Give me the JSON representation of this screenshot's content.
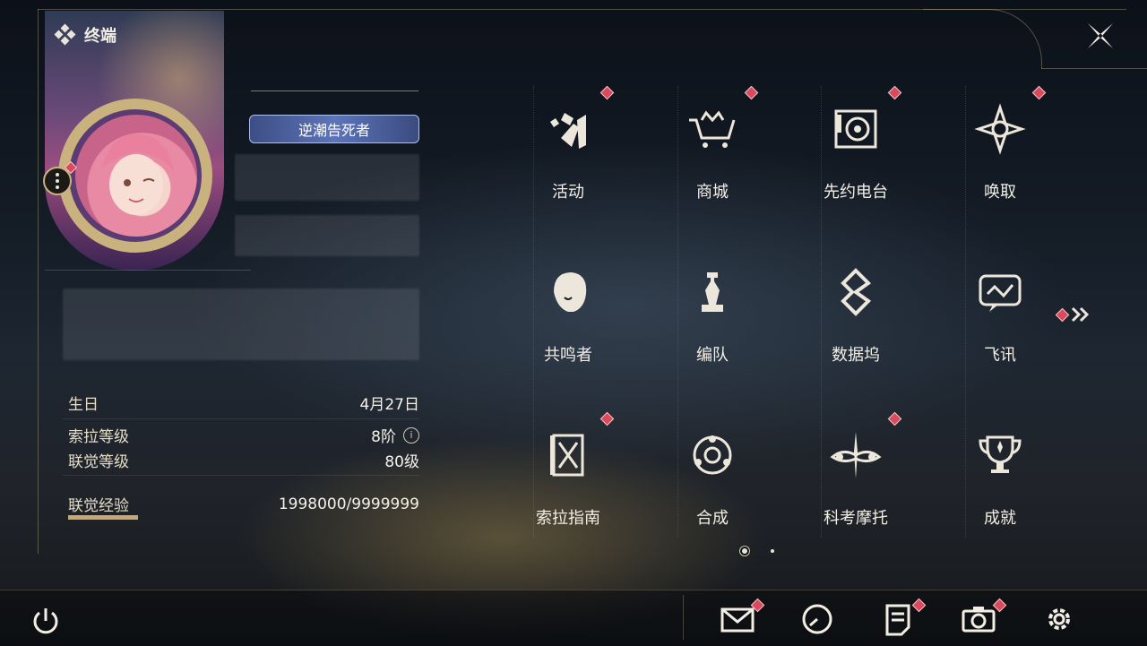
{
  "header": {
    "title": "终端"
  },
  "profile": {
    "badge_title": "逆潮告死者",
    "stats": [
      {
        "label": "生日",
        "value": "4月27日"
      },
      {
        "label": "索拉等级",
        "value": "8阶"
      },
      {
        "label": "联觉等级",
        "value": "80级"
      },
      {
        "label": "联觉经验",
        "value": "1998000/9999999"
      }
    ]
  },
  "grid": {
    "items": [
      {
        "label": "活动",
        "icon": "activity-icon",
        "badge": true
      },
      {
        "label": "商城",
        "icon": "shop-cart-icon",
        "badge": true
      },
      {
        "label": "先约电台",
        "icon": "radio-icon",
        "badge": true
      },
      {
        "label": "唤取",
        "icon": "summon-star-icon",
        "badge": true
      },
      {
        "label": "共鸣者",
        "icon": "resonator-head-icon",
        "badge": false
      },
      {
        "label": "编队",
        "icon": "team-chess-icon",
        "badge": false
      },
      {
        "label": "数据坞",
        "icon": "databank-icon",
        "badge": false
      },
      {
        "label": "飞讯",
        "icon": "message-icon",
        "badge": false
      },
      {
        "label": "索拉指南",
        "icon": "guide-book-icon",
        "badge": true
      },
      {
        "label": "合成",
        "icon": "synthesis-icon",
        "badge": false
      },
      {
        "label": "科考摩托",
        "icon": "motorcycle-icon",
        "badge": true
      },
      {
        "label": "成就",
        "icon": "trophy-icon",
        "badge": false
      }
    ]
  },
  "pager": {
    "pages": 2,
    "current": 1
  },
  "bottom_bar": {
    "icons": [
      "mail-icon",
      "clock-icon",
      "notice-icon",
      "camera-icon",
      "settings-gear-icon"
    ]
  },
  "colors": {
    "accent_gold": "#c9a773",
    "badge_red": "#d84a5c",
    "text": "#eee9dc"
  }
}
